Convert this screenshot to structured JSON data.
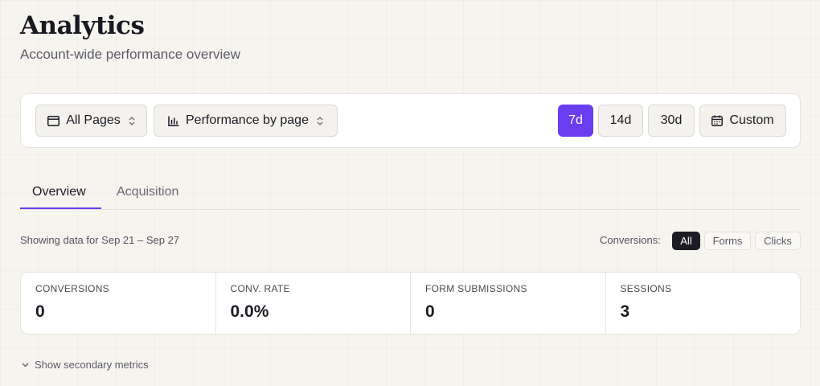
{
  "header": {
    "title": "Analytics",
    "subtitle": "Account-wide performance overview"
  },
  "toolbar": {
    "pages_select": {
      "label": "All Pages",
      "icon": "browser-window-icon"
    },
    "view_select": {
      "label": "Performance by page",
      "icon": "bar-chart-icon"
    },
    "ranges": [
      {
        "label": "7d",
        "active": true
      },
      {
        "label": "14d",
        "active": false
      },
      {
        "label": "30d",
        "active": false
      }
    ],
    "custom": {
      "label": "Custom",
      "icon": "calendar-icon"
    },
    "accent_color": "#6a3df0"
  },
  "tabs": [
    {
      "label": "Overview",
      "active": true
    },
    {
      "label": "Acquisition",
      "active": false
    }
  ],
  "filters": {
    "range_text": "Showing data for Sep 21 – Sep 27",
    "conversions_label": "Conversions:",
    "chips": [
      {
        "label": "All",
        "active": true
      },
      {
        "label": "Forms",
        "active": false
      },
      {
        "label": "Clicks",
        "active": false
      }
    ]
  },
  "metrics": [
    {
      "label": "CONVERSIONS",
      "value": "0"
    },
    {
      "label": "CONV. RATE",
      "value": "0.0%"
    },
    {
      "label": "FORM SUBMISSIONS",
      "value": "0"
    },
    {
      "label": "SESSIONS",
      "value": "3"
    }
  ],
  "secondary": {
    "label": "Show secondary metrics",
    "icon": "chevron-down-icon"
  }
}
